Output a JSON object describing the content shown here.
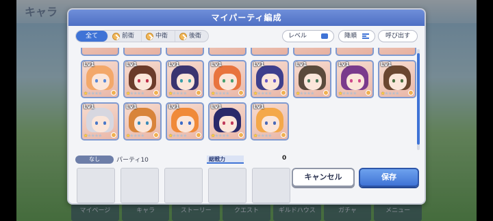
{
  "background": {
    "title": "キャラ",
    "tabs": [
      "マイページ",
      "キャラ",
      "ストーリー",
      "クエスト",
      "ギルドハウス",
      "ガチャ",
      "メニュー"
    ]
  },
  "dialog": {
    "title": "マイパーティ編成",
    "filters": [
      {
        "label": "全て",
        "active": true
      },
      {
        "label": "前衛",
        "active": false
      },
      {
        "label": "中衛",
        "active": false
      },
      {
        "label": "後衛",
        "active": false
      }
    ],
    "level_button": "レベル",
    "sort_button": "降順",
    "recall_button": "呼び出す",
    "characters_row1": [
      {
        "lv": "Lv1",
        "hair": "#f3a86a",
        "eye": "#5a88d8",
        "stars": 1
      },
      {
        "lv": "Lv1",
        "hair": "#6b3b2a",
        "eye": "#c0304a",
        "stars": 1
      },
      {
        "lv": "Lv1",
        "hair": "#3a3470",
        "eye": "#3aa0a8",
        "stars": 1
      },
      {
        "lv": "Lv1",
        "hair": "#e8743e",
        "eye": "#48a070",
        "stars": 1
      },
      {
        "lv": "Lv1",
        "hair": "#3e3f8c",
        "eye": "#6a58c8",
        "stars": 1
      },
      {
        "lv": "Lv1",
        "hair": "#5a4a3c",
        "eye": "#4a7a5a",
        "stars": 1
      },
      {
        "lv": "Lv1",
        "hair": "#7a3a8c",
        "eye": "#d04a8a",
        "stars": 1
      },
      {
        "lv": "Lv1",
        "hair": "#6a4630",
        "eye": "#4a7040",
        "stars": 1
      }
    ],
    "characters_row2": [
      {
        "lv": "Lv1",
        "hair": "#d7d7e0",
        "eye": "#4a78c8",
        "stars": 1
      },
      {
        "lv": "Lv1",
        "hair": "#d8843a",
        "eye": "#3a8ab8",
        "stars": 1
      },
      {
        "lv": "Lv1",
        "hair": "#f08a3a",
        "eye": "#3a6ac8",
        "stars": 1
      },
      {
        "lv": "Lv1",
        "hair": "#2a2a6a",
        "eye": "#c03a5a",
        "stars": 1
      },
      {
        "lv": "Lv1",
        "hair": "#f4a84a",
        "eye": "#4a6ab8",
        "stars": 1
      }
    ],
    "party": {
      "tag": "なし",
      "name": "パーティ10",
      "power_label": "総戦力",
      "power_value": "0"
    },
    "cancel_button": "キャンセル",
    "save_button": "保存",
    "accent_color": "#3f73d6"
  }
}
